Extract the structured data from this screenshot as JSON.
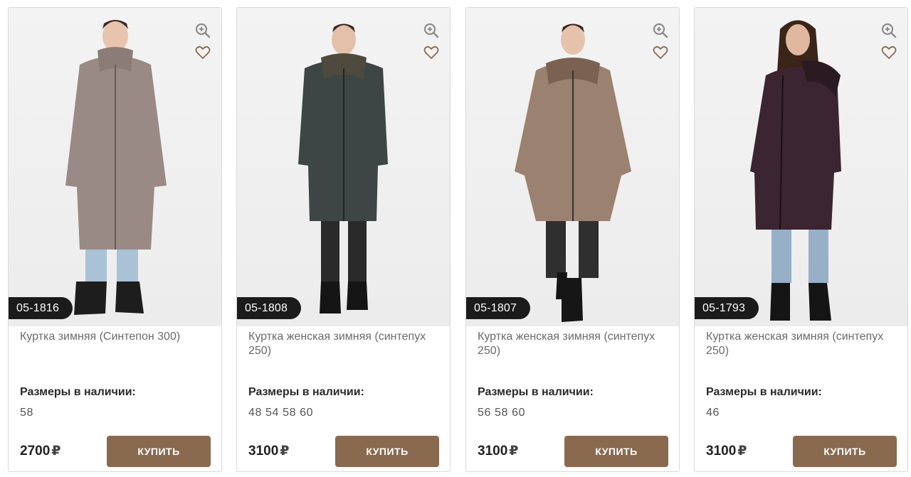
{
  "icons": {
    "zoom": "zoom-in-icon",
    "favorite": "heart-icon"
  },
  "colors": {
    "buy_button": "#8a6a4f",
    "sku_badge": "#1b1b1b"
  },
  "products": [
    {
      "sku": "05-1816",
      "title": "Куртка зимняя (Синтепон 300)",
      "sizes_label": "Размеры в наличии:",
      "sizes": "58",
      "price": "2700",
      "currency": "₽",
      "buy_label": "КУПИТЬ",
      "coat_color": "#9a8a86"
    },
    {
      "sku": "05-1808",
      "title": "Куртка женская зимняя (синтепух 250)",
      "sizes_label": "Размеры в наличии:",
      "sizes": "48 54 58 60",
      "price": "3100",
      "currency": "₽",
      "buy_label": "КУПИТЬ",
      "coat_color": "#3d4645"
    },
    {
      "sku": "05-1807",
      "title": "Куртка женская зимняя (синтепух 250)",
      "sizes_label": "Размеры в наличии:",
      "sizes": "56 58 60",
      "price": "3100",
      "currency": "₽",
      "buy_label": "КУПИТЬ",
      "coat_color": "#9b8170"
    },
    {
      "sku": "05-1793",
      "title": "Куртка женская зимняя (синтепух 250)",
      "sizes_label": "Размеры в наличии:",
      "sizes": "46",
      "price": "3100",
      "currency": "₽",
      "buy_label": "КУПИТЬ",
      "coat_color": "#3a2530"
    }
  ]
}
